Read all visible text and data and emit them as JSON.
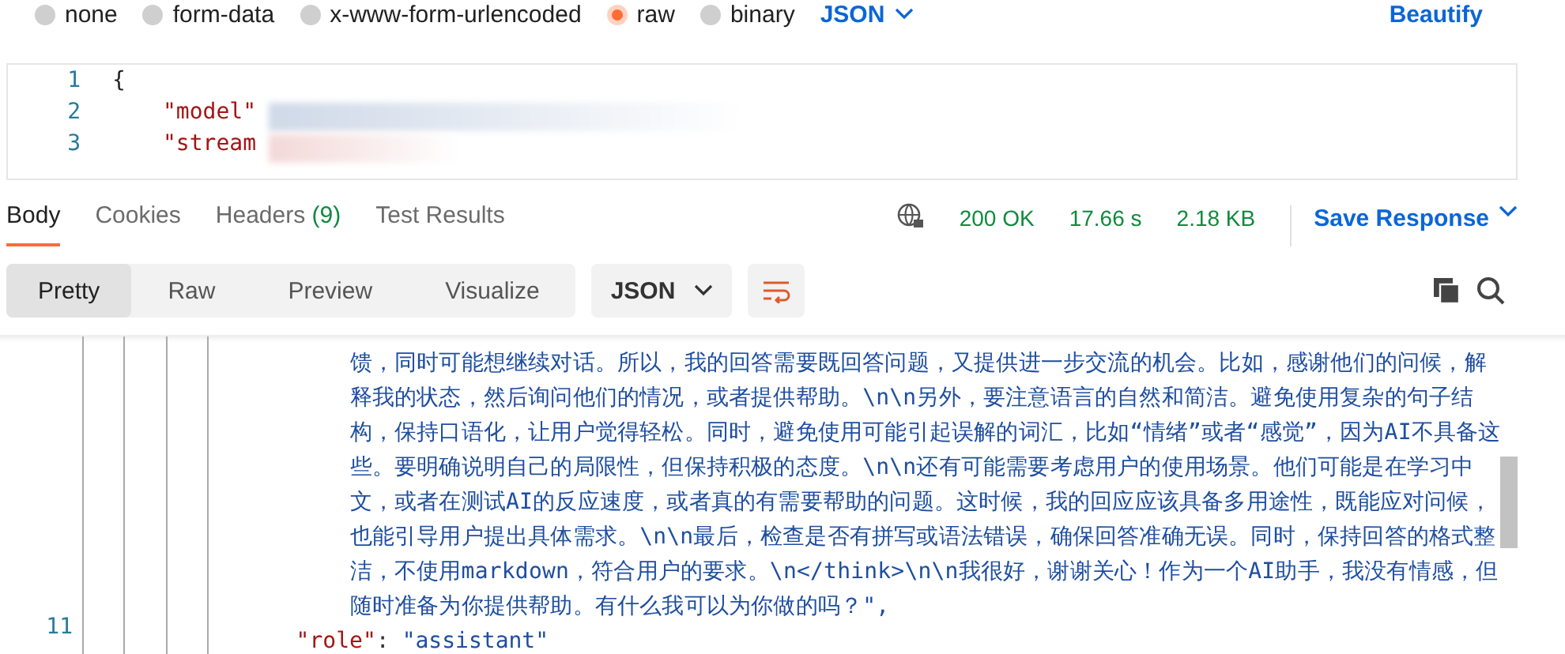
{
  "body_types": [
    {
      "label": "none",
      "selected": false
    },
    {
      "label": "form-data",
      "selected": false
    },
    {
      "label": "x-www-form-urlencoded",
      "selected": false
    },
    {
      "label": "raw",
      "selected": true
    },
    {
      "label": "binary",
      "selected": false
    }
  ],
  "format": "JSON",
  "beautify": "Beautify",
  "request_editor": {
    "lines": [
      {
        "number": "1",
        "kind": "brace",
        "text": "{"
      },
      {
        "number": "2",
        "kind": "key",
        "text": "\"model\""
      },
      {
        "number": "3",
        "kind": "key",
        "text": "\"stream"
      }
    ]
  },
  "response_tabs": [
    {
      "label": "Body",
      "selected": true
    },
    {
      "label": "Cookies",
      "selected": false
    },
    {
      "label": "Headers",
      "count": "(9)",
      "selected": false
    },
    {
      "label": "Test Results",
      "selected": false
    }
  ],
  "status": {
    "code": "200 OK",
    "time": "17.66 s",
    "size": "2.18 KB"
  },
  "save_response": "Save Response",
  "view_modes": [
    {
      "label": "Pretty",
      "selected": true
    },
    {
      "label": "Raw",
      "selected": false
    },
    {
      "label": "Preview",
      "selected": false
    },
    {
      "label": "Visualize",
      "selected": false
    }
  ],
  "response_format": "JSON",
  "response_body": {
    "text_lines": [
      "馈，同时可能想继续对话。所以，我的回答需要既回答问题，又提供进一步交流的机会。比如，感谢他们的问候，解",
      "释我的状态，然后询问他们的情况，或者提供帮助。\\n\\n另外，要注意语言的自然和简洁。避免使用复杂的句子结",
      "构，保持口语化，让用户觉得轻松。同时，避免使用可能引起误解的词汇，比如“情绪”或者“感觉”，因为AI不具备这",
      "些。要明确说明自己的局限性，但保持积极的态度。\\n\\n还有可能需要考虑用户的使用场景。他们可能是在学习中",
      "文，或者在测试AI的反应速度，或者真的有需要帮助的问题。这时候，我的回应应该具备多用途性，既能应对问候，",
      "也能引导用户提出具体需求。\\n\\n最后，检查是否有拼写或语法错误，确保回答准确无误。同时，保持回答的格式整",
      "洁，不使用markdown，符合用户的要求。\\n</think>\\n\\n我很好，谢谢关心！作为一个AI助手，我没有情感，但",
      "随时准备为你提供帮助。有什么我可以为你做的吗？\","
    ],
    "last_line": {
      "number": "11",
      "key": "\"role\"",
      "colon": ":",
      "value": "\"assistant\""
    }
  }
}
